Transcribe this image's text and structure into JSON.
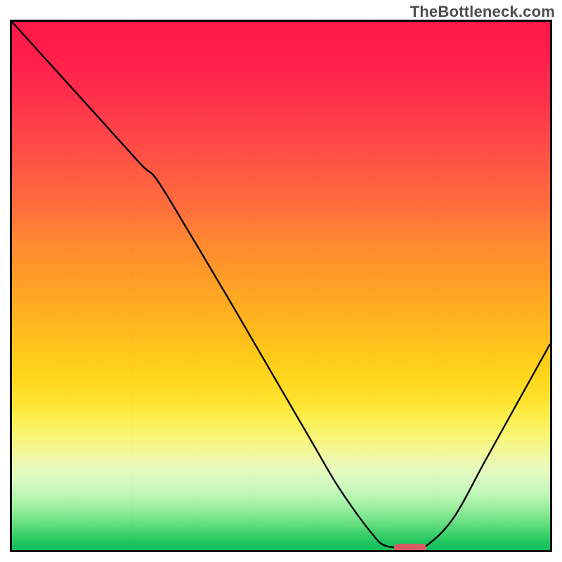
{
  "watermark": "TheBottleneck.com",
  "colors": {
    "frame": "#000000",
    "curve": "#000000",
    "marker": "#d95a63"
  },
  "chart_data": {
    "type": "line",
    "title": "",
    "xlabel": "",
    "ylabel": "",
    "xlim": [
      0,
      100
    ],
    "ylim": [
      0,
      100
    ],
    "grid": false,
    "legend": false,
    "series": [
      {
        "name": "curve",
        "x": [
          0,
          8,
          16,
          24,
          27,
          33,
          40,
          48,
          56,
          60,
          64,
          67,
          69,
          72,
          75,
          77,
          82,
          88,
          94,
          100
        ],
        "y": [
          100,
          91,
          82,
          73,
          70,
          60,
          48,
          34,
          20,
          13,
          7,
          3,
          1,
          0.4,
          0.4,
          0.8,
          6,
          17,
          28,
          39
        ]
      }
    ],
    "marker": {
      "x_start": 71,
      "x_end": 77,
      "y": 0.4
    },
    "note": "Values are estimated from pixel positions; y is percent of plot height from bottom, x is percent of plot width from left."
  }
}
